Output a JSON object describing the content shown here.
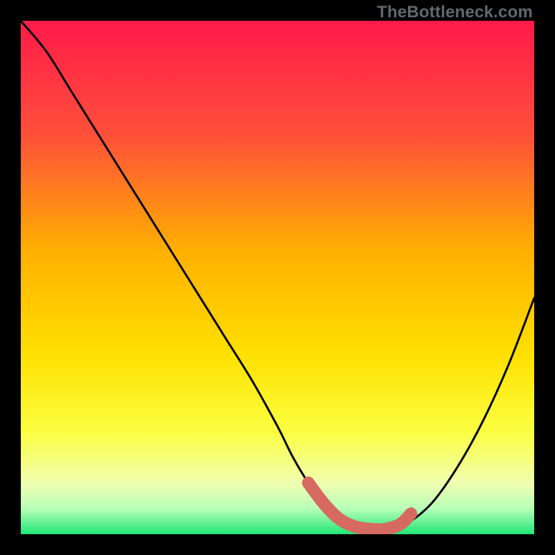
{
  "watermark": "TheBottleneck.com",
  "colors": {
    "frame": "#000000",
    "gradient_top": "#ff1a4a",
    "gradient_upper_mid": "#ff7a2a",
    "gradient_mid": "#ffd400",
    "gradient_lower_mid": "#f7ff4a",
    "gradient_near_bottom": "#d8ffae",
    "gradient_bottom": "#20e676",
    "curve": "#000000",
    "highlight": "#d66a62"
  },
  "chart_data": {
    "type": "line",
    "title": "",
    "xlabel": "",
    "ylabel": "",
    "xlim": [
      0,
      100
    ],
    "ylim": [
      0,
      100
    ],
    "grid": false,
    "legend": false,
    "series": [
      {
        "name": "bottleneck-curve",
        "x": [
          0,
          5,
          10,
          15,
          20,
          25,
          30,
          35,
          40,
          45,
          50,
          53,
          56,
          59,
          62,
          65,
          68,
          71,
          75,
          80,
          85,
          90,
          95,
          100
        ],
        "y": [
          100,
          94,
          86,
          78,
          70,
          62,
          54,
          46,
          38,
          30,
          21,
          15,
          10,
          6,
          3,
          1.5,
          1,
          1,
          2,
          6,
          13,
          22,
          33,
          46
        ]
      }
    ],
    "highlight_segment": {
      "name": "optimal-range",
      "x": [
        56,
        59,
        62,
        65,
        68,
        71,
        74,
        76
      ],
      "y": [
        10,
        6,
        3,
        1.5,
        1,
        1,
        2,
        4
      ]
    }
  }
}
